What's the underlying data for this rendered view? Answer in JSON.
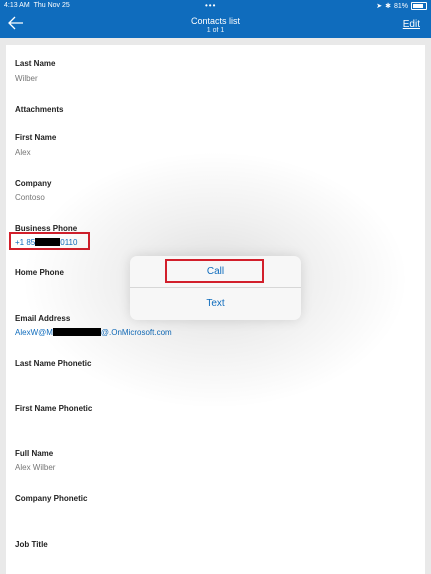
{
  "status": {
    "time": "4:13 AM",
    "day": "Thu Nov 25",
    "dots": "•••",
    "battery": "81%"
  },
  "header": {
    "title": "Contacts list",
    "subtitle": "1 of 1",
    "edit": "Edit"
  },
  "fields": [
    {
      "label": "Last Name",
      "value": "Wilber"
    },
    {
      "label": "Attachments",
      "value": ""
    },
    {
      "label": "First Name",
      "value": "Alex"
    },
    {
      "label": "Company",
      "value": "Contoso"
    },
    {
      "label": "Business Phone",
      "value_prefix": "+1 85",
      "value_suffix": "0110"
    },
    {
      "label": "Home Phone",
      "value": ""
    },
    {
      "label": "Email Address",
      "value_prefix": "AlexW@M",
      "value_suffix": "@.OnMicrosoft.com"
    },
    {
      "label": "Last Name Phonetic",
      "value": ""
    },
    {
      "label": "First Name Phonetic",
      "value": ""
    },
    {
      "label": "Full Name",
      "value": "Alex Wilber"
    },
    {
      "label": "Company Phonetic",
      "value": ""
    },
    {
      "label": "Job Title",
      "value": ""
    }
  ],
  "popover": {
    "call": "Call",
    "text": "Text"
  },
  "colors": {
    "header": "#0f6cbd",
    "link": "#0f6cbd",
    "highlight": "#d21f2b"
  }
}
